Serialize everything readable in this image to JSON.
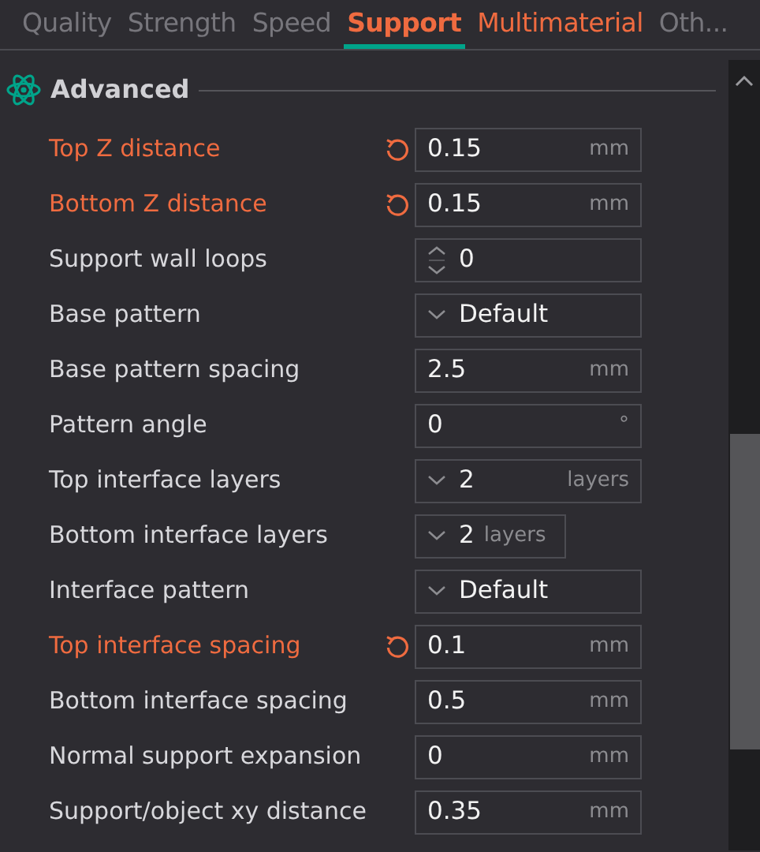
{
  "tabs": [
    {
      "label": "Quality",
      "selected": false,
      "modified": false
    },
    {
      "label": "Strength",
      "selected": false,
      "modified": false
    },
    {
      "label": "Speed",
      "selected": false,
      "modified": false
    },
    {
      "label": "Support",
      "selected": true,
      "modified": true
    },
    {
      "label": "Multimaterial",
      "selected": false,
      "modified": true
    },
    {
      "label": "Oth...",
      "selected": false,
      "modified": false
    }
  ],
  "section": {
    "title": "Advanced"
  },
  "rows": [
    {
      "label": "Top Z distance",
      "modified": true,
      "kind": "input",
      "value": "0.15",
      "unit": "mm"
    },
    {
      "label": "Bottom Z distance",
      "modified": true,
      "kind": "input",
      "value": "0.15",
      "unit": "mm"
    },
    {
      "label": "Support wall loops",
      "modified": false,
      "kind": "spin",
      "value": "0"
    },
    {
      "label": "Base pattern",
      "modified": false,
      "kind": "combo",
      "value": "Default"
    },
    {
      "label": "Base pattern spacing",
      "modified": false,
      "kind": "input",
      "value": "2.5",
      "unit": "mm"
    },
    {
      "label": "Pattern angle",
      "modified": false,
      "kind": "input",
      "value": "0",
      "unit": "°"
    },
    {
      "label": "Top interface layers",
      "modified": false,
      "kind": "combo",
      "value": "2",
      "unit": "layers"
    },
    {
      "label": "Bottom interface layers",
      "modified": false,
      "kind": "combo-short",
      "value": "2",
      "unit": "layers"
    },
    {
      "label": "Interface pattern",
      "modified": false,
      "kind": "combo",
      "value": "Default"
    },
    {
      "label": "Top interface spacing",
      "modified": true,
      "kind": "input",
      "value": "0.1",
      "unit": "mm"
    },
    {
      "label": "Bottom interface spacing",
      "modified": false,
      "kind": "input",
      "value": "0.5",
      "unit": "mm"
    },
    {
      "label": "Normal support expansion",
      "modified": false,
      "kind": "input",
      "value": "0",
      "unit": "mm"
    },
    {
      "label": "Support/object xy distance",
      "modified": false,
      "kind": "input",
      "value": "0.35",
      "unit": "mm"
    }
  ]
}
